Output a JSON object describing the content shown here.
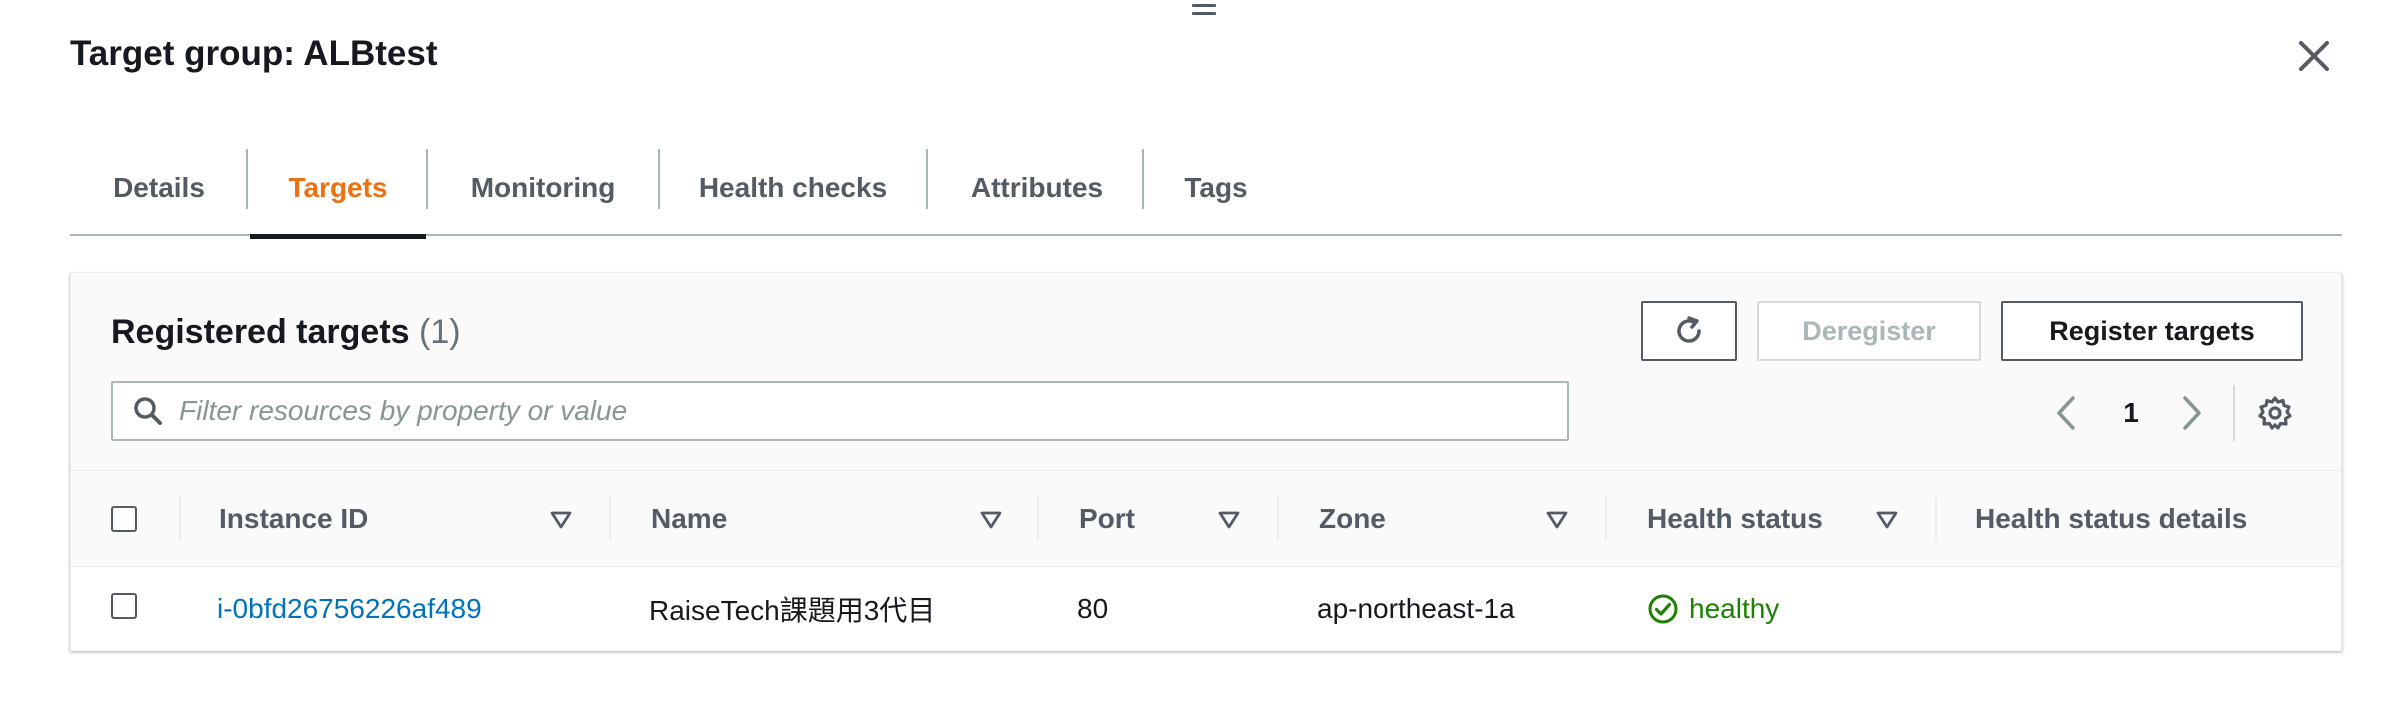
{
  "panel": {
    "title": "Target group: ALBtest"
  },
  "tabs": [
    {
      "label": "Details"
    },
    {
      "label": "Targets"
    },
    {
      "label": "Monitoring"
    },
    {
      "label": "Health checks"
    },
    {
      "label": "Attributes"
    },
    {
      "label": "Tags"
    }
  ],
  "registered": {
    "title": "Registered targets",
    "count": "(1)",
    "deregister_label": "Deregister",
    "register_label": "Register targets",
    "search_placeholder": "Filter resources by property or value",
    "current_page": "1"
  },
  "table": {
    "headers": {
      "instance_id": "Instance ID",
      "name": "Name",
      "port": "Port",
      "zone": "Zone",
      "health_status": "Health status",
      "health_details": "Health status details"
    },
    "rows": [
      {
        "instance_id": "i-0bfd26756226af489",
        "name": "RaiseTech課題用3代目",
        "port": "80",
        "zone": "ap-northeast-1a",
        "health_status": "healthy",
        "health_details": ""
      }
    ]
  },
  "colors": {
    "active_tab": "#ec7211",
    "link": "#0073bb",
    "healthy": "#1d8102"
  },
  "icons": [
    "drag-handle-icon",
    "close-icon",
    "refresh-icon",
    "search-icon",
    "chevron-left-icon",
    "chevron-right-icon",
    "settings-gear-icon",
    "sort-icon",
    "status-ok-icon"
  ]
}
